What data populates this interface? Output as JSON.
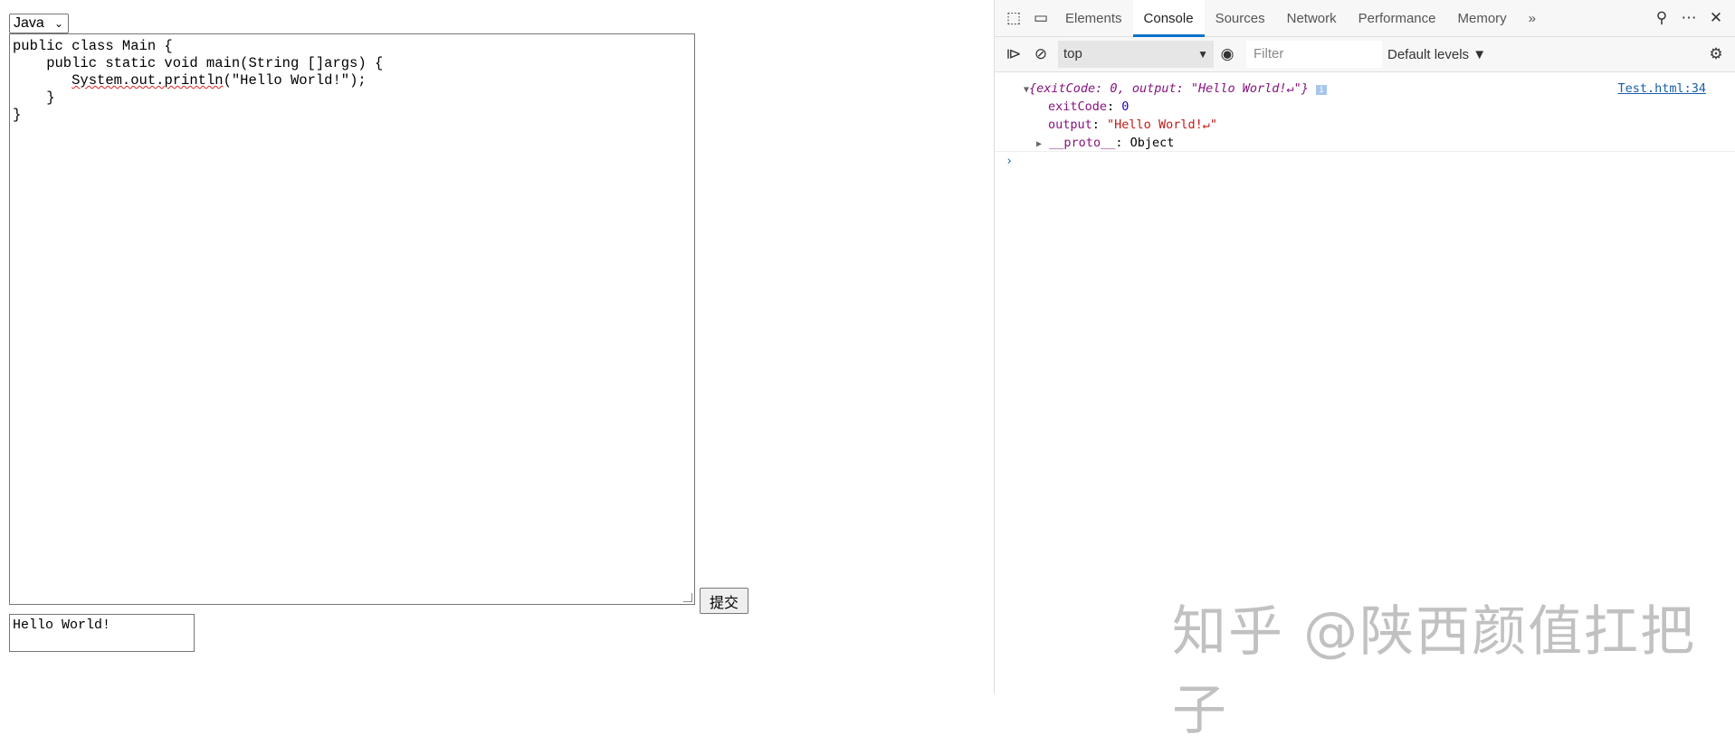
{
  "editor": {
    "language": "Java",
    "code_lines": [
      "public class Main {",
      "    public static void main(String []args) {",
      "       ",
      "    }",
      "}"
    ],
    "code_call": "System.out.println",
    "code_rest": "(\"Hello World!\");",
    "submit_label": "提交",
    "output": "Hello World!"
  },
  "devtools": {
    "tabs": [
      "Elements",
      "Console",
      "Sources",
      "Network",
      "Performance",
      "Memory"
    ],
    "more": "»",
    "context": "top",
    "filter_placeholder": "Filter",
    "levels": "Default levels ▼",
    "log": {
      "summary": "{exitCode: 0, output: \"Hello World!↵\"}",
      "exitCode_key": "exitCode",
      "exitCode_val": "0",
      "output_key": "output",
      "output_val": "\"Hello World!↵\"",
      "proto_key": "__proto__",
      "proto_val": "Object",
      "source": "Test.html:34"
    },
    "prompt": "›"
  },
  "watermark": "知乎 @陕西颜值扛把子"
}
